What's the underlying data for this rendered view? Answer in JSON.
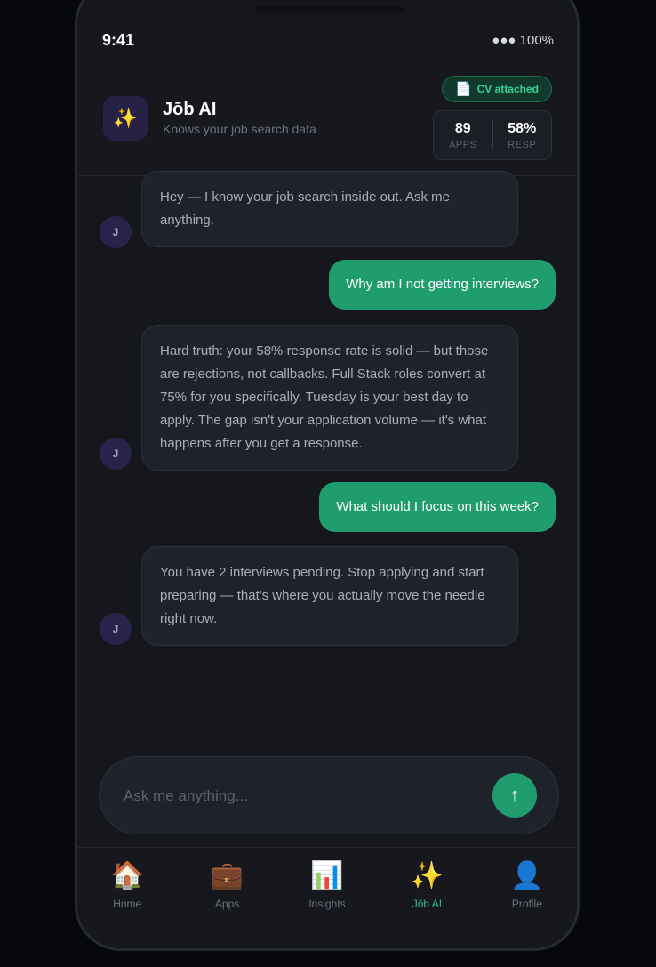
{
  "status_bar": {
    "time": "9:41",
    "battery": "●●● 100%"
  },
  "header": {
    "app_icon": "sparkles-icon",
    "title": "Jōb AI",
    "subtitle": "Knows your job search data",
    "cv_badge": {
      "icon": "document-icon",
      "label": "CV attached"
    },
    "stats": {
      "apps": {
        "value": "89",
        "label": "APPS"
      },
      "resp": {
        "value": "58%",
        "label": "RESP"
      }
    }
  },
  "messages": [
    {
      "role": "ai",
      "avatar": "J",
      "text": "Hey — I know your job search inside out. Ask me anything."
    },
    {
      "role": "user",
      "text": "Why am I not getting interviews?"
    },
    {
      "role": "ai",
      "avatar": "J",
      "text": "Hard truth: your 58% response rate is solid — but those are rejections, not callbacks. Full Stack roles convert at 75% for you specifically. Tuesday is your best day to apply. The gap isn't your application volume — it's what happens after you get a response."
    },
    {
      "role": "user",
      "text": "What should I focus on this week?"
    },
    {
      "role": "ai",
      "avatar": "J",
      "text": "You have 2 interviews pending. Stop applying and start preparing — that's where you actually move the needle right now."
    }
  ],
  "composer": {
    "placeholder": "Ask me anything...",
    "value": "",
    "send_icon": "↑"
  },
  "tabs": [
    {
      "label": "Home",
      "icon": "🏠",
      "icon_name": "home-icon",
      "active": false
    },
    {
      "label": "Apps",
      "icon": "💼",
      "icon_name": "briefcase-icon",
      "active": false
    },
    {
      "label": "Insights",
      "icon": "📊",
      "icon_name": "bar-chart-icon",
      "active": false
    },
    {
      "label": "Jōb AI",
      "icon": "✨",
      "icon_name": "sparkles-icon",
      "active": true
    },
    {
      "label": "Profile",
      "icon": "👤",
      "icon_name": "profile-icon",
      "active": false
    }
  ],
  "colors": {
    "accent": "#1f9d6e",
    "accent_text": "#2bbf85",
    "background": "#15171c",
    "bubble_ai": "#1e222b"
  }
}
